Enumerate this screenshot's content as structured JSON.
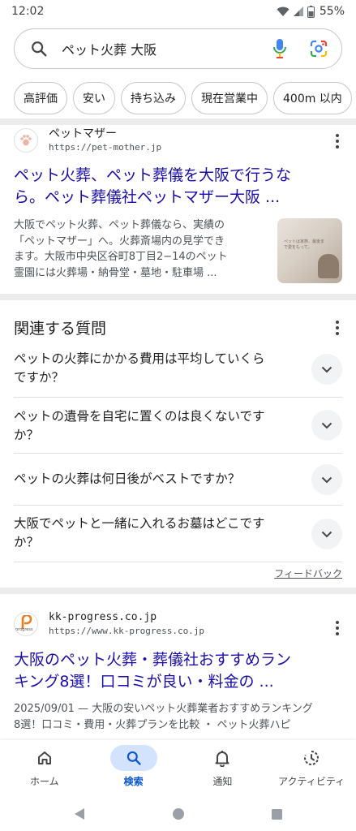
{
  "status_bar": {
    "time": "12:02",
    "battery": "55%"
  },
  "search": {
    "query": "ペット火葬 大阪"
  },
  "chips": [
    "高評価",
    "安い",
    "持ち込み",
    "現在営業中",
    "400m 以内"
  ],
  "result1": {
    "site_name": "ペットマザー",
    "url": "https://pet-mother.jp",
    "title_line1": "ペット火葬、ペット葬儀を大阪で行うな",
    "title_line2": "ら。ペット葬儀社ペットマザー大阪 ...",
    "snippet": [
      "大阪でペット火葬、ペット葬儀なら、実績の",
      "「ペットマザー」へ。火葬斎場内の見学でき",
      "ます。大阪市中央区谷町8丁目2−14のペット",
      "霊園には火葬場・納骨堂・墓地・駐車場 ..."
    ],
    "thumb_text": "ペットは家族、最後まで愛をもって。"
  },
  "paa": {
    "title": "関連する質問",
    "questions": [
      [
        "ペットの火葬にかかる費用は平均していくら",
        "ですか？"
      ],
      [
        "ペットの遺骨を自宅に置くのは良くないです",
        "か？"
      ],
      [
        "ペットの火葬は何日後がベストですか？"
      ],
      [
        "大阪でペットと一緒に入れるお墓はどこです",
        "か？"
      ]
    ],
    "feedback": "フィードバック"
  },
  "result2": {
    "site_name": "kk-progress.co.jp",
    "url": "https://www.kk-progress.co.jp",
    "favicon_text": "progress",
    "title_line1": "大阪のペット火葬・葬儀社おすすめラン",
    "title_line2": "キング8選！口コミが良い・料金の ...",
    "snippet": [
      "2025/09/01 — 大阪の安いペット火葬業者おすすめランキング",
      "8選！口コミ・費用・火葬プランを比較 ・ ペット火葬ハピ"
    ]
  },
  "bottom_nav": [
    {
      "label": "ホーム",
      "icon": "home-icon"
    },
    {
      "label": "検索",
      "icon": "search-icon"
    },
    {
      "label": "通知",
      "icon": "bell-icon"
    },
    {
      "label": "アクティビティ",
      "icon": "activity-icon"
    }
  ],
  "colors": {
    "link": "#1a0dab",
    "accent": "#0b57d0",
    "active_pill": "#d3e3fd"
  }
}
